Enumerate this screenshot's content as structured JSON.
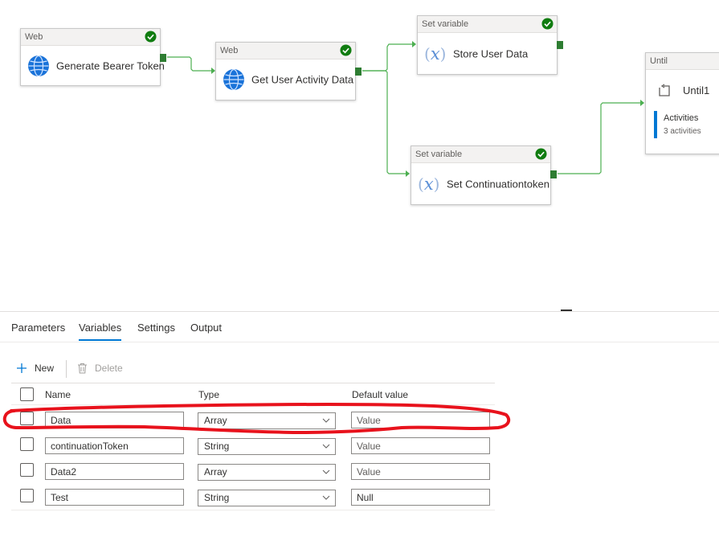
{
  "pipeline": {
    "nodes": [
      {
        "category": "Web",
        "label": "Generate Bearer Token"
      },
      {
        "category": "Web",
        "label": "Get User Activity Data"
      },
      {
        "category": "Set variable",
        "label": "Store User Data"
      },
      {
        "category": "Set variable",
        "label": "Set Continuationtoken"
      },
      {
        "category": "Until",
        "label": "Until1",
        "activities_label": "Activities",
        "activities_count": "3 activities"
      }
    ]
  },
  "tabs": [
    {
      "label": "Parameters",
      "active": false
    },
    {
      "label": "Variables",
      "active": true
    },
    {
      "label": "Settings",
      "active": false
    },
    {
      "label": "Output",
      "active": false
    }
  ],
  "toolbar": {
    "new_label": "New",
    "delete_label": "Delete"
  },
  "table": {
    "headers": {
      "name": "Name",
      "type": "Type",
      "default": "Default value"
    },
    "rows": [
      {
        "name": "Data",
        "type": "Array",
        "default_placeholder": "Value",
        "default_value": ""
      },
      {
        "name": "continuationToken",
        "type": "String",
        "default_placeholder": "Value",
        "default_value": ""
      },
      {
        "name": "Data2",
        "type": "Array",
        "default_placeholder": "Value",
        "default_value": ""
      },
      {
        "name": "Test",
        "type": "String",
        "default_placeholder": "",
        "default_value": "Null"
      }
    ]
  },
  "colors": {
    "success": "#107c10",
    "connector": "#2e7d32",
    "accent": "#0078d4",
    "annotation": "#e8121c"
  }
}
